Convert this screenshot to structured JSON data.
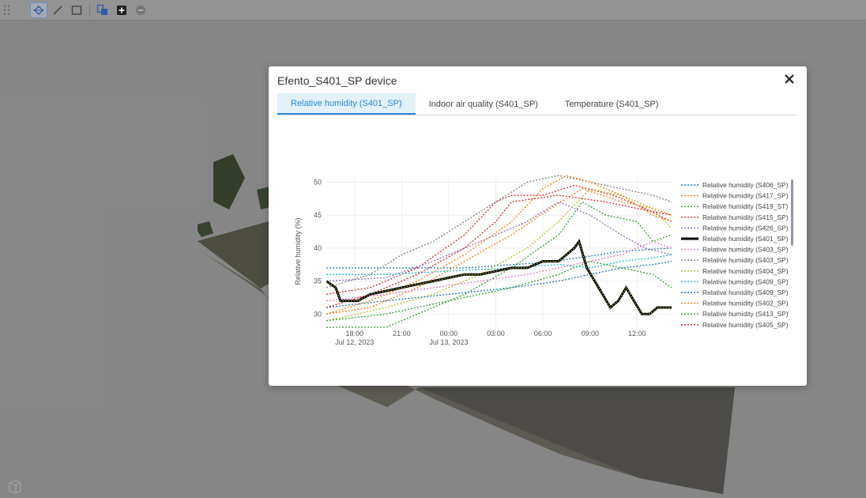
{
  "modal": {
    "title": "Efento_S401_SP device"
  },
  "tabs": [
    {
      "label": "Relative humidity (S401_SP)",
      "active": true
    },
    {
      "label": "Indoor air quality (S401_SP)",
      "active": false
    },
    {
      "label": "Temperature (S401_SP)",
      "active": false
    }
  ],
  "icons": {
    "close": "close-icon",
    "toolbar": [
      "drag-handle-icon",
      "point-tool-icon",
      "line-tool-icon",
      "rectangle-tool-icon",
      "layers-icon",
      "add-icon",
      "remove-icon"
    ]
  },
  "chart_data": {
    "type": "line",
    "ylabel": "Relative humidity (%)",
    "yticks": [
      30,
      35,
      40,
      45,
      50
    ],
    "ylim": [
      28,
      51
    ],
    "xlim": [
      16.2,
      38.2
    ],
    "xticks": [
      {
        "value": 18,
        "label": "18:00",
        "sublabel": "Jul 12, 2023"
      },
      {
        "value": 21,
        "label": "21:00",
        "sublabel": ""
      },
      {
        "value": 24,
        "label": "00:00",
        "sublabel": "Jul 13, 2023"
      },
      {
        "value": 27,
        "label": "03:00",
        "sublabel": ""
      },
      {
        "value": 30,
        "label": "06:00",
        "sublabel": ""
      },
      {
        "value": 33,
        "label": "09:00",
        "sublabel": ""
      },
      {
        "value": 36,
        "label": "12:00",
        "sublabel": ""
      }
    ],
    "series": [
      {
        "name": "Relative humidity (S406_SP)",
        "color": "#1f77b4",
        "x": [
          16.2,
          25,
          30,
          32.5,
          35,
          38.2
        ],
        "y": [
          37,
          37,
          37.8,
          38.6,
          39.5,
          40
        ]
      },
      {
        "name": "Relative humidity (S417_SP)",
        "color": "#ff7f0e",
        "x": [
          16.2,
          19,
          22,
          25,
          28,
          30.5,
          32.5,
          35,
          37,
          38.2
        ],
        "y": [
          30,
          31,
          34,
          38,
          42,
          46,
          49,
          47,
          46,
          45
        ]
      },
      {
        "name": "Relative humidity (S419_ST)",
        "color": "#2ca02c",
        "x": [
          16.2,
          20,
          22,
          25,
          28,
          31,
          32.5,
          34,
          36,
          37,
          38.2
        ],
        "y": [
          28,
          28,
          30,
          33,
          37,
          42,
          47,
          45,
          44,
          41,
          42
        ]
      },
      {
        "name": "Relative humidity (S415_SP)",
        "color": "#d62728",
        "x": [
          16.2,
          19,
          22,
          25,
          27,
          28,
          30,
          32,
          34.5,
          36.5,
          38.2
        ],
        "y": [
          33,
          34,
          37,
          42,
          47,
          48,
          48,
          49.5,
          48,
          46,
          44
        ]
      },
      {
        "name": "Relative humidity (S426_SP)",
        "color": "#9467bd",
        "x": [
          16.2,
          20,
          23,
          26,
          29,
          31,
          33,
          35,
          36.5,
          38.2
        ],
        "y": [
          35,
          35.5,
          38,
          41,
          44,
          47,
          45,
          42,
          40,
          39
        ]
      },
      {
        "name": "Relative humidity (S401_SP)",
        "color": "#000000",
        "highlight": true,
        "x": [
          16.2,
          16.8,
          17.1,
          18.2,
          19,
          20,
          21,
          22,
          23,
          24,
          25,
          26,
          27,
          28,
          29,
          30,
          31,
          32,
          32.3,
          32.8,
          33.3,
          33.8,
          34.3,
          34.8,
          35.3,
          35.8,
          36.3,
          36.8,
          37.3,
          38.2
        ],
        "y": [
          35,
          34,
          32,
          32,
          33,
          33.5,
          34,
          34.5,
          35,
          35.5,
          36,
          36,
          36.5,
          37,
          37,
          38,
          38,
          40,
          41,
          37,
          35,
          33,
          31,
          32,
          34,
          32,
          30,
          30,
          31,
          31
        ]
      },
      {
        "name": "Relative humidity (S403_SP)",
        "color": "#e377c2",
        "x": [
          16.2,
          20,
          23,
          26,
          29,
          31,
          33,
          35,
          37,
          38.2
        ],
        "y": [
          32,
          33,
          34,
          35,
          36,
          37,
          38,
          39,
          41,
          40
        ]
      },
      {
        "name": "Relative humidity (S403_SP)",
        "color": "#7f7f7f",
        "x": [
          16.2,
          19,
          21,
          23,
          25,
          27,
          29,
          31,
          33,
          35,
          37,
          38.2
        ],
        "y": [
          34,
          36,
          39,
          41,
          44,
          47,
          50,
          51,
          50,
          49,
          48,
          47
        ]
      },
      {
        "name": "Relative humidity (S404_SP)",
        "color": "#bcbd22",
        "x": [
          16.2,
          20,
          23,
          26,
          29,
          31,
          33,
          35,
          37,
          38.2
        ],
        "y": [
          29,
          31,
          33,
          36,
          40,
          44,
          49,
          48,
          46,
          43
        ]
      },
      {
        "name": "Relative humidity (S409_SP)",
        "color": "#17becf",
        "x": [
          16.2,
          20,
          24,
          28,
          31,
          33,
          35,
          37,
          38.2
        ],
        "y": [
          36,
          36,
          36.5,
          37,
          37.5,
          37,
          38,
          38.5,
          39
        ]
      },
      {
        "name": "Relative humidity (S409_SP)",
        "color": "#1f77b4",
        "x": [
          16.2,
          20,
          24,
          28,
          31,
          33,
          35,
          37,
          38.2
        ],
        "y": [
          31,
          32,
          33,
          34,
          35,
          36,
          37,
          37.5,
          38
        ]
      },
      {
        "name": "Relative humidity (S402_SP)",
        "color": "#ff7f0e",
        "x": [
          16.2,
          19,
          22,
          25,
          28,
          30,
          31.5,
          33,
          35,
          37,
          38.2
        ],
        "y": [
          30,
          32,
          35,
          39,
          44,
          49,
          51,
          50,
          48,
          45,
          44
        ]
      },
      {
        "name": "Relative humidity (S413_SP)",
        "color": "#2ca02c",
        "x": [
          16.2,
          20,
          24,
          28,
          31,
          33,
          35,
          37,
          38.2
        ],
        "y": [
          29,
          30,
          32,
          34,
          36,
          38,
          37,
          36,
          34
        ]
      },
      {
        "name": "Relative humidity (S405_SP)",
        "color": "#d62728",
        "x": [
          16.2,
          19,
          22,
          25,
          27,
          28,
          31,
          34,
          36,
          38.2
        ],
        "y": [
          31,
          33,
          36,
          40,
          44,
          47,
          48,
          47,
          46,
          45
        ]
      }
    ]
  }
}
